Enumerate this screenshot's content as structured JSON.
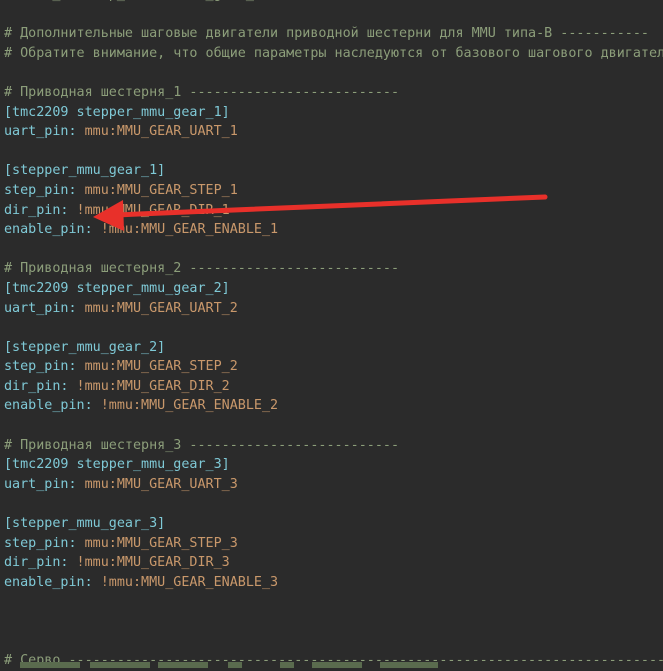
{
  "lines": [
    {
      "type": "comment",
      "text": "#extra_endstop_names: mmu_gear_touch"
    },
    {
      "type": "blank",
      "text": ""
    },
    {
      "type": "comment",
      "text": "# Дополнительные шаговые двигатели приводной шестерни для MMU типа-B -----------"
    },
    {
      "type": "comment",
      "text": "# Обратите внимание, что общие параметры наследуются от базового шагового двигателя"
    },
    {
      "type": "blank",
      "text": ""
    },
    {
      "type": "comment",
      "text": "# Приводная шестерня_1 --------------------------"
    },
    {
      "type": "section",
      "text": "[tmc2209 stepper_mmu_gear_1]"
    },
    {
      "type": "kv",
      "key": "uart_pin:",
      "value": " mmu:MMU_GEAR_UART_1"
    },
    {
      "type": "blank",
      "text": ""
    },
    {
      "type": "section",
      "text": "[stepper_mmu_gear_1]"
    },
    {
      "type": "kv",
      "key": "step_pin:",
      "value": " mmu:MMU_GEAR_STEP_1"
    },
    {
      "type": "kv",
      "key": "dir_pin:",
      "value": " !mmu:MMU_GEAR_DIR_1"
    },
    {
      "type": "kv",
      "key": "enable_pin:",
      "value": " !mmu:MMU_GEAR_ENABLE_1"
    },
    {
      "type": "blank",
      "text": ""
    },
    {
      "type": "comment",
      "text": "# Приводная шестерня_2 --------------------------"
    },
    {
      "type": "section",
      "text": "[tmc2209 stepper_mmu_gear_2]"
    },
    {
      "type": "kv",
      "key": "uart_pin:",
      "value": " mmu:MMU_GEAR_UART_2"
    },
    {
      "type": "blank",
      "text": ""
    },
    {
      "type": "section",
      "text": "[stepper_mmu_gear_2]"
    },
    {
      "type": "kv",
      "key": "step_pin:",
      "value": " mmu:MMU_GEAR_STEP_2"
    },
    {
      "type": "kv",
      "key": "dir_pin:",
      "value": " !mmu:MMU_GEAR_DIR_2"
    },
    {
      "type": "kv",
      "key": "enable_pin:",
      "value": " !mmu:MMU_GEAR_ENABLE_2"
    },
    {
      "type": "blank",
      "text": ""
    },
    {
      "type": "comment",
      "text": "# Приводная шестерня_3 --------------------------"
    },
    {
      "type": "section",
      "text": "[tmc2209 stepper_mmu_gear_3]"
    },
    {
      "type": "kv",
      "key": "uart_pin:",
      "value": " mmu:MMU_GEAR_UART_3"
    },
    {
      "type": "blank",
      "text": ""
    },
    {
      "type": "section",
      "text": "[stepper_mmu_gear_3]"
    },
    {
      "type": "kv",
      "key": "step_pin:",
      "value": " mmu:MMU_GEAR_STEP_3"
    },
    {
      "type": "kv",
      "key": "dir_pin:",
      "value": " !mmu:MMU_GEAR_DIR_3"
    },
    {
      "type": "kv",
      "key": "enable_pin:",
      "value": " !mmu:MMU_GEAR_ENABLE_3"
    },
    {
      "type": "blank",
      "text": ""
    },
    {
      "type": "blank",
      "text": ""
    },
    {
      "type": "blank",
      "text": ""
    },
    {
      "type": "comment",
      "text": "# Серво -----------------------------------------------------------------------------"
    }
  ],
  "colors": {
    "background": "#2b2b2b",
    "comment": "#8c9e7a",
    "section": "#7fc9d6",
    "value": "#c9986b",
    "annotation_arrow": "#e8302a"
  },
  "annotation": {
    "icon": "red-arrow-icon"
  }
}
